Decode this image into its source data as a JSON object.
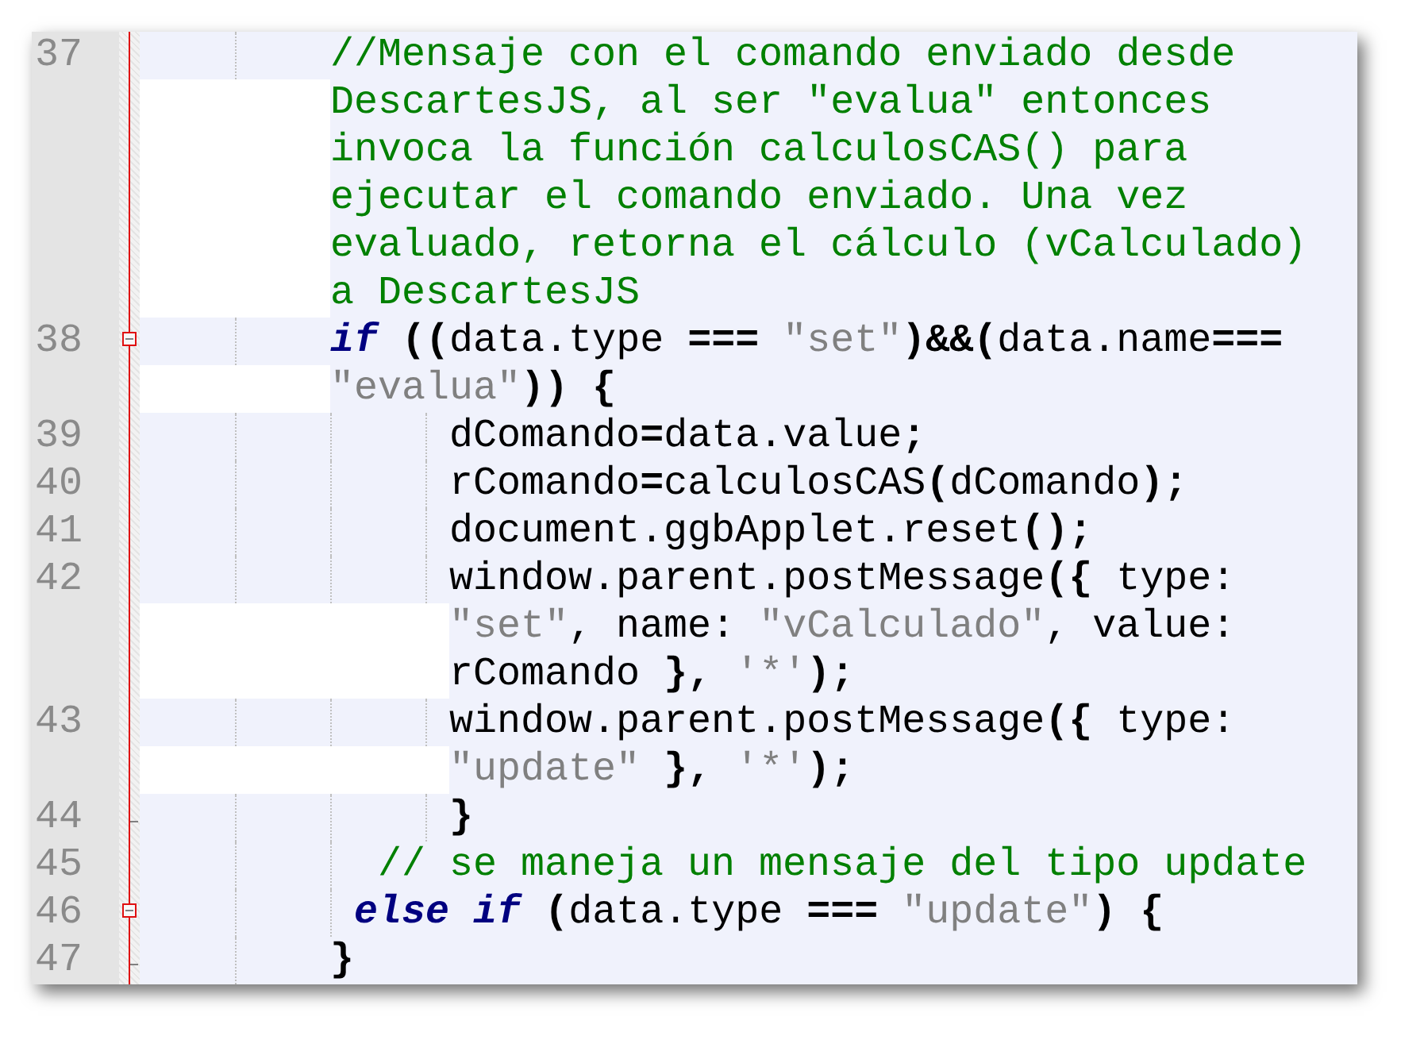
{
  "editor": {
    "lines": [
      {
        "number": "37",
        "kind": "plain",
        "rows": [
          {
            "tokens": [
              {
                "kind": "comment",
                "text": "        //Mensaje con el comando enviado desde"
              }
            ]
          },
          {
            "tokens": [
              {
                "kind": "comment",
                "text": "DescartesJS, al ser \"evalua\" entonces"
              }
            ]
          },
          {
            "tokens": [
              {
                "kind": "comment",
                "text": "invoca la función calculosCAS() para"
              }
            ]
          },
          {
            "tokens": [
              {
                "kind": "comment",
                "text": "ejecutar el comando enviado. Una vez"
              }
            ]
          },
          {
            "tokens": [
              {
                "kind": "comment",
                "text": "evaluado, retorna el cálculo (vCalculado)"
              }
            ]
          },
          {
            "tokens": [
              {
                "kind": "comment",
                "text": "a DescartesJS"
              }
            ]
          }
        ]
      },
      {
        "number": "38",
        "kind": "fold_start",
        "rows": [
          {
            "tokens": [
              {
                "kind": "keyword",
                "text": "        if"
              },
              {
                "kind": "op",
                "text": " (("
              },
              {
                "kind": "text",
                "text": "data.type "
              },
              {
                "kind": "op",
                "text": "==="
              },
              {
                "kind": "string",
                "text": " \"set\""
              },
              {
                "kind": "op",
                "text": ")&&("
              },
              {
                "kind": "text",
                "text": "data.name"
              },
              {
                "kind": "op",
                "text": "==="
              }
            ]
          },
          {
            "tokens": [
              {
                "kind": "string",
                "text": "\"evalua\""
              },
              {
                "kind": "op",
                "text": ")) {"
              }
            ]
          }
        ]
      },
      {
        "number": "39",
        "kind": "plain",
        "rows": [
          {
            "tokens": [
              {
                "kind": "text",
                "text": "             dComando"
              },
              {
                "kind": "op",
                "text": "="
              },
              {
                "kind": "text",
                "text": "data.value"
              },
              {
                "kind": "op",
                "text": ";"
              }
            ]
          }
        ]
      },
      {
        "number": "40",
        "kind": "plain",
        "rows": [
          {
            "tokens": [
              {
                "kind": "text",
                "text": "             rComando"
              },
              {
                "kind": "op",
                "text": "="
              },
              {
                "kind": "text",
                "text": "calculosCAS"
              },
              {
                "kind": "op",
                "text": "("
              },
              {
                "kind": "text",
                "text": "dComando"
              },
              {
                "kind": "op",
                "text": ");"
              }
            ]
          }
        ]
      },
      {
        "number": "41",
        "kind": "plain",
        "rows": [
          {
            "tokens": [
              {
                "kind": "text",
                "text": "             document.ggbApplet.reset"
              },
              {
                "kind": "op",
                "text": "();"
              }
            ]
          }
        ]
      },
      {
        "number": "42",
        "kind": "plain",
        "rows": [
          {
            "tokens": [
              {
                "kind": "text",
                "text": "             window.parent.postMessage"
              },
              {
                "kind": "op",
                "text": "({"
              },
              {
                "kind": "text",
                "text": " type:"
              }
            ]
          },
          {
            "tokens": [
              {
                "kind": "string",
                "text": "\"set\""
              },
              {
                "kind": "text",
                "text": ", name: "
              },
              {
                "kind": "string",
                "text": "\"vCalculado\""
              },
              {
                "kind": "text",
                "text": ", value:"
              }
            ]
          },
          {
            "tokens": [
              {
                "kind": "text",
                "text": "rComando "
              },
              {
                "kind": "op",
                "text": "},"
              },
              {
                "kind": "string",
                "text": " '*'"
              },
              {
                "kind": "op",
                "text": ");"
              }
            ]
          }
        ]
      },
      {
        "number": "43",
        "kind": "plain",
        "rows": [
          {
            "tokens": [
              {
                "kind": "text",
                "text": "             window.parent.postMessage"
              },
              {
                "kind": "op",
                "text": "({"
              },
              {
                "kind": "text",
                "text": " type:"
              }
            ]
          },
          {
            "tokens": [
              {
                "kind": "string",
                "text": "\"update\""
              },
              {
                "kind": "op",
                "text": " },"
              },
              {
                "kind": "string",
                "text": " '*'"
              },
              {
                "kind": "op",
                "text": ");"
              }
            ]
          }
        ]
      },
      {
        "number": "44",
        "kind": "fold_end",
        "rows": [
          {
            "tokens": [
              {
                "kind": "op",
                "text": "             }"
              }
            ]
          }
        ]
      },
      {
        "number": "45",
        "kind": "plain",
        "rows": [
          {
            "tokens": [
              {
                "kind": "comment",
                "text": "          // se maneja un mensaje del tipo update"
              }
            ]
          }
        ]
      },
      {
        "number": "46",
        "kind": "fold_start",
        "rows": [
          {
            "tokens": [
              {
                "kind": "keyword",
                "text": "         else"
              },
              {
                "kind": "keyword",
                "text": " if"
              },
              {
                "kind": "op",
                "text": " ("
              },
              {
                "kind": "text",
                "text": "data.type "
              },
              {
                "kind": "op",
                "text": "==="
              },
              {
                "kind": "string",
                "text": " \"update\""
              },
              {
                "kind": "op",
                "text": ") {"
              }
            ]
          }
        ]
      },
      {
        "number": "47",
        "kind": "fold_end",
        "rows": [
          {
            "tokens": [
              {
                "kind": "op",
                "text": "        }"
              }
            ]
          }
        ]
      }
    ]
  }
}
